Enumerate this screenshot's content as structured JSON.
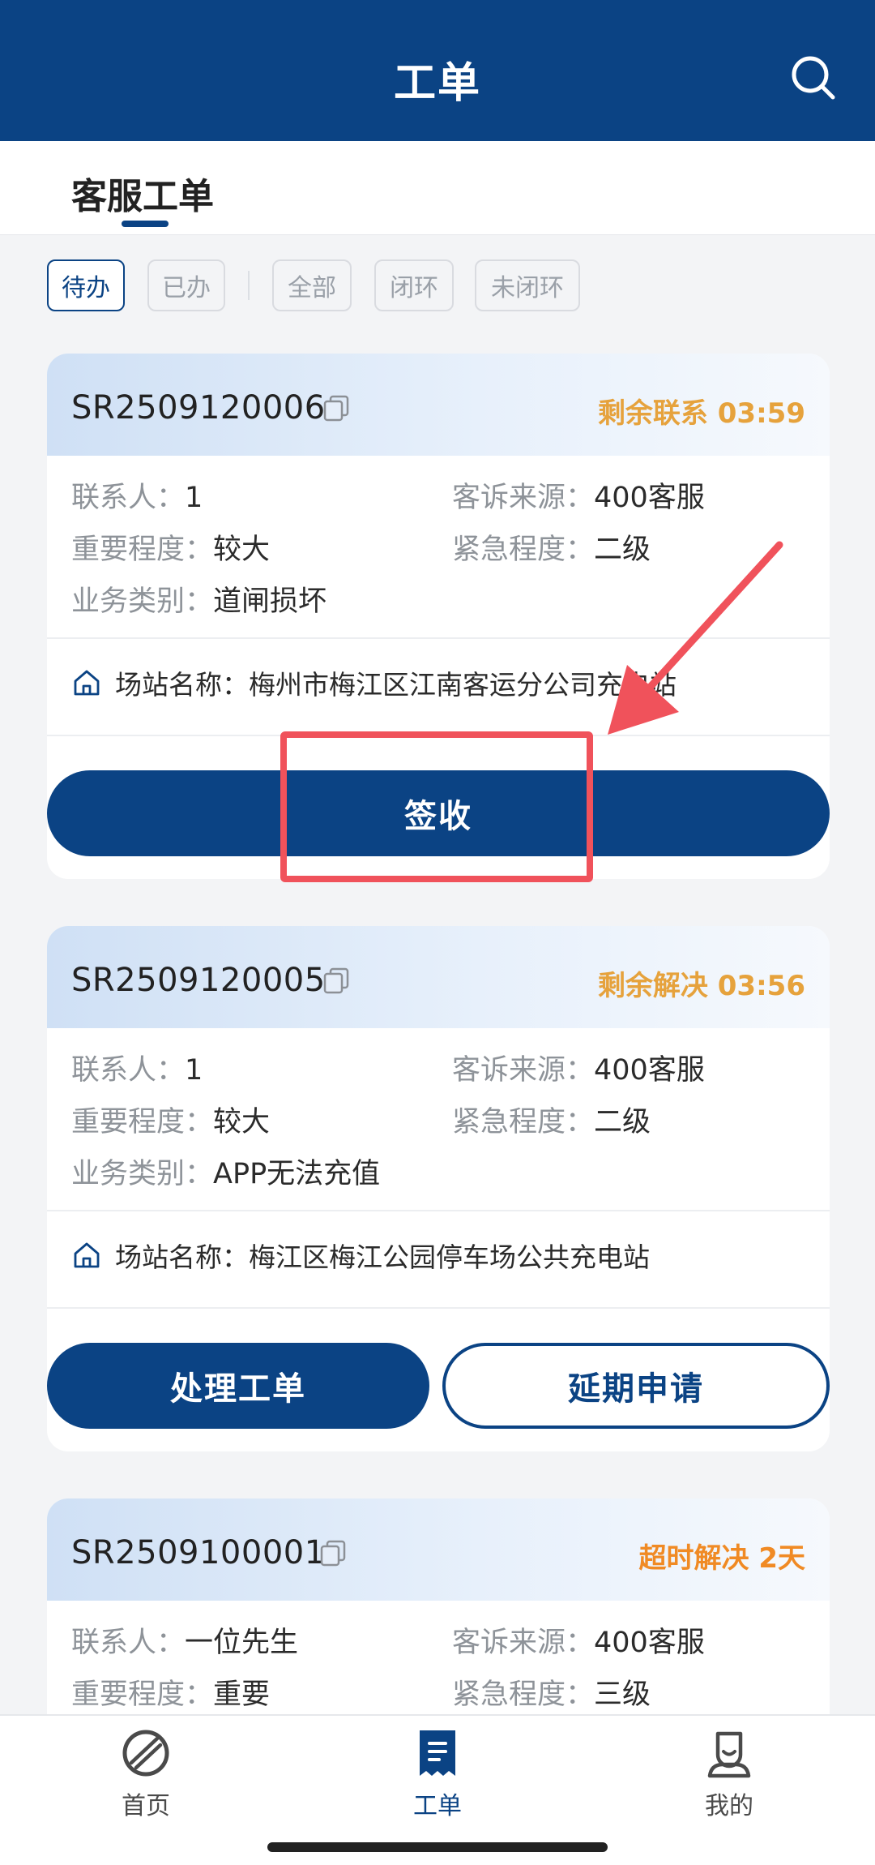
{
  "header": {
    "title": "工单"
  },
  "tabs": {
    "main": "客服工单"
  },
  "filters": [
    "待办",
    "已办",
    "全部",
    "闭环",
    "未闭环"
  ],
  "labels": {
    "contact": "联系人：",
    "source": "客诉来源：",
    "importance": "重要程度：",
    "urgency": "紧急程度：",
    "category": "业务类别：",
    "station": "场站名称："
  },
  "cards": [
    {
      "id": "SR2509120006",
      "status": "剩余联系 03:59",
      "contact": "1",
      "source": "400客服",
      "importance": "较大",
      "urgency": "二级",
      "category": "道闸损坏",
      "station": "梅州市梅江区江南客运分公司充电站",
      "buttons": [
        "签收"
      ]
    },
    {
      "id": "SR2509120005",
      "status": "剩余解决 03:56",
      "contact": "1",
      "source": "400客服",
      "importance": "较大",
      "urgency": "二级",
      "category": "APP无法充值",
      "station": "梅江区梅江公园停车场公共充电站",
      "buttons": [
        "处理工单",
        "延期申请"
      ]
    },
    {
      "id": "SR2509100001",
      "status": "超时解决 2天",
      "contact": "一位先生",
      "source": "400客服",
      "importance": "重要",
      "urgency": "三级"
    }
  ],
  "bottom_nav": [
    {
      "label": "首页",
      "icon": "home-globe-icon"
    },
    {
      "label": "工单",
      "icon": "document-icon"
    },
    {
      "label": "我的",
      "icon": "user-icon"
    }
  ],
  "colors": {
    "primary": "#0b4384",
    "warning": "#e6a23c",
    "overdue": "#f08a24",
    "annotation": "#f0525b"
  }
}
